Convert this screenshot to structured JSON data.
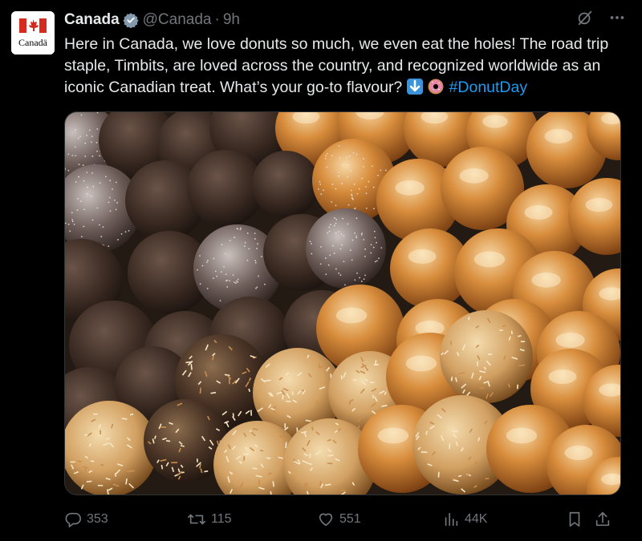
{
  "account": {
    "name": "Canada",
    "handle": "@Canada",
    "time": "9h",
    "avatar_text": "Canadä"
  },
  "tweet": {
    "text_1": "Here in Canada, we love donuts so much, we even eat the holes! The road trip staple, Timbits, are loved across the country, and recognized worldwide as an iconic Canadian treat. What’s your go-to flavour? ",
    "hashtag": "#DonutDay"
  },
  "metrics": {
    "replies": "353",
    "retweets": "115",
    "likes": "551",
    "views": "44K"
  },
  "icons": {
    "verified": "verified-badge-icon",
    "more": "more-icon",
    "grok": "grok-icon",
    "reply": "reply-icon",
    "retweet": "retweet-icon",
    "like": "heart-icon",
    "views": "views-icon",
    "bookmark": "bookmark-icon",
    "share": "share-icon",
    "down_arrow_emoji": "down-arrow-emoji-icon",
    "donut_emoji": "donut-emoji-icon"
  },
  "colors": {
    "background": "#000000",
    "text": "#e7e9ea",
    "muted": "#71767b",
    "link": "#1d9bf0",
    "canada_red": "#d52b1e"
  }
}
